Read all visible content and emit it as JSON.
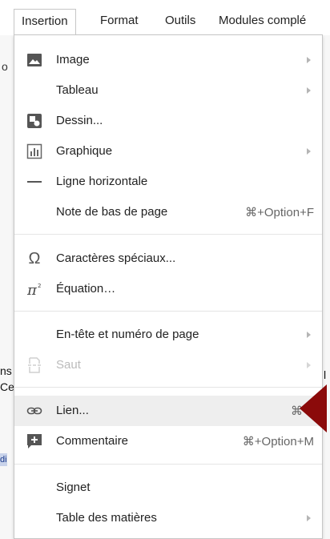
{
  "menubar": {
    "items": [
      "Insertion",
      "Format",
      "Outils",
      "Modules complé"
    ],
    "active_index": 0
  },
  "background_fragments": {
    "left_top": "o",
    "left_mid1": "ns",
    "left_mid2": "Ce",
    "left_mid3": "di",
    "right_mid": "l"
  },
  "menu": {
    "items": [
      {
        "label": "Image",
        "icon": "image-icon",
        "submenu": true
      },
      {
        "label": "Tableau",
        "icon": "",
        "submenu": true
      },
      {
        "label": "Dessin...",
        "icon": "drawing-icon",
        "submenu": false
      },
      {
        "label": "Graphique",
        "icon": "chart-icon",
        "submenu": true
      },
      {
        "label": "Ligne horizontale",
        "icon": "horizontal-line-icon",
        "submenu": false
      },
      {
        "label": "Note de bas de page",
        "icon": "",
        "shortcut": "⌘+Option+F"
      },
      {
        "label": "Caractères spéciaux...",
        "icon": "omega-icon",
        "submenu": false
      },
      {
        "label": "Équation…",
        "icon": "pi-icon",
        "submenu": false
      },
      {
        "label": "En-tête et numéro de page",
        "icon": "",
        "submenu": true
      },
      {
        "label": "Saut",
        "icon": "page-break-icon",
        "submenu": true,
        "disabled": true
      },
      {
        "label": "Lien...",
        "icon": "link-icon",
        "shortcut": "⌘",
        "highlighted": true
      },
      {
        "label": "Commentaire",
        "icon": "comment-icon",
        "shortcut": "⌘+Option+M"
      },
      {
        "label": "Signet",
        "icon": ""
      },
      {
        "label": "Table des matières",
        "icon": "",
        "submenu": true
      }
    ]
  },
  "colors": {
    "highlight": "#eeeeee",
    "annotation_arrow": "#8b0a0a",
    "icon_dark": "#555555"
  }
}
